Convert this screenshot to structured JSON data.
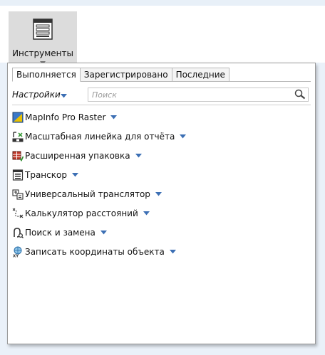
{
  "ribbon": {
    "tools_button": {
      "label": "Инструменты",
      "icon": "tools-icon"
    }
  },
  "panel": {
    "tabs": [
      {
        "label": "Выполняется",
        "active": true
      },
      {
        "label": "Зарегистрировано",
        "active": false
      },
      {
        "label": "Последние",
        "active": false
      }
    ],
    "settings_label": "Настройки",
    "search": {
      "value": "",
      "placeholder": "Поиск",
      "icon": "search-icon"
    },
    "tools": [
      {
        "label": "MapInfo Pro Raster",
        "icon": "raster-icon"
      },
      {
        "label": "Масштабная линейка для отчёта",
        "icon": "scalebar-icon"
      },
      {
        "label": "Расширенная упаковка",
        "icon": "packager-icon"
      },
      {
        "label": "Транскор",
        "icon": "transcor-icon"
      },
      {
        "label": "Универсальный транслятор",
        "icon": "translator-icon"
      },
      {
        "label": "Калькулятор расстояний",
        "icon": "distance-icon"
      },
      {
        "label": "Поиск и замена",
        "icon": "find-replace-icon"
      },
      {
        "label": "Записать координаты объекта",
        "icon": "coordinates-icon"
      }
    ]
  },
  "colors": {
    "caret_blue": "#3c6fb4",
    "ribbon_bg": "#eaf1f9",
    "button_pressed": "#dcdcdc"
  }
}
